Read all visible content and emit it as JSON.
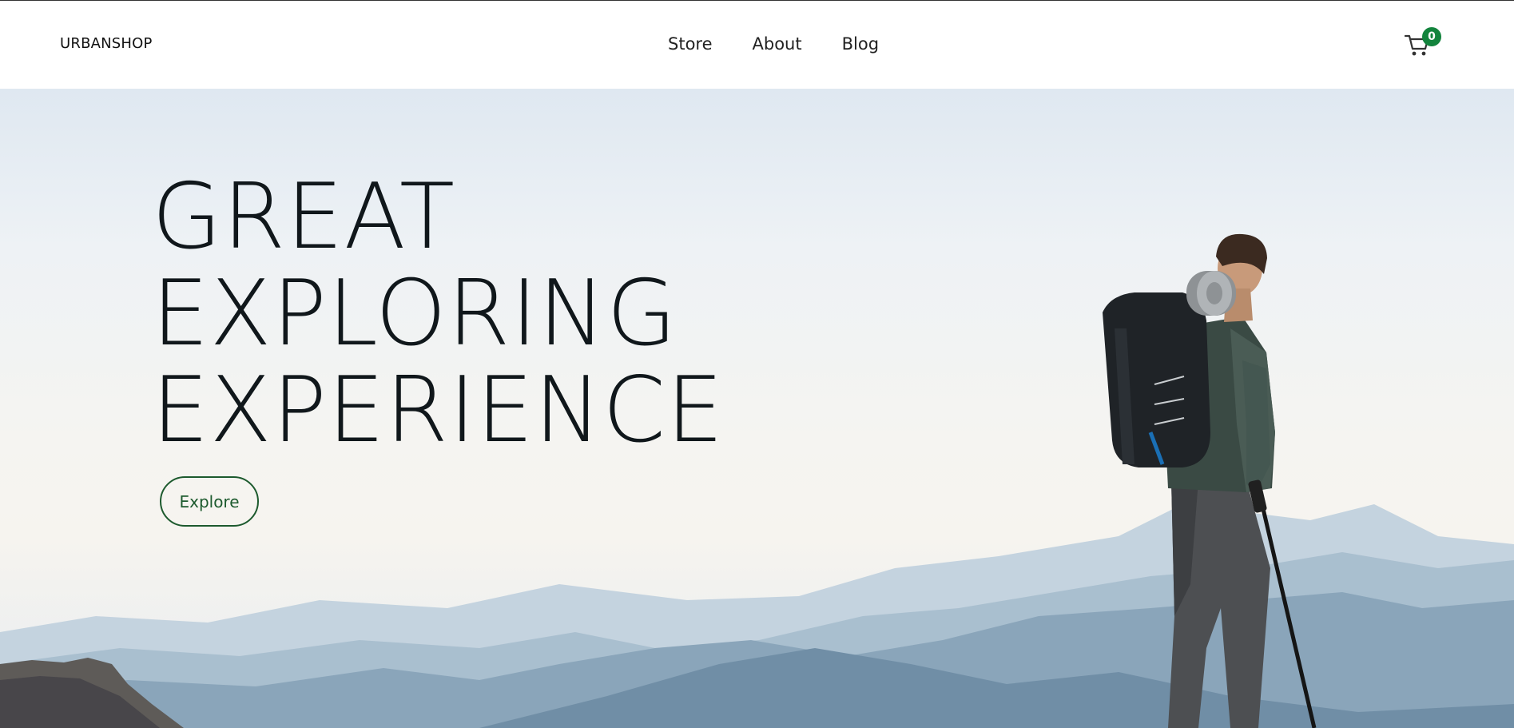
{
  "header": {
    "logo": "URBANSHOP",
    "nav": [
      "Store",
      "About",
      "Blog"
    ],
    "cart_count": "0"
  },
  "hero": {
    "headline": [
      "GREAT",
      "EXPLORING",
      "EXPERIENCE"
    ],
    "cta_label": "Explore"
  },
  "colors": {
    "accent_green": "#13843d",
    "button_green": "#1d5a2e",
    "text_dark": "#10171b"
  },
  "icons": {
    "cart": "cart-icon"
  }
}
